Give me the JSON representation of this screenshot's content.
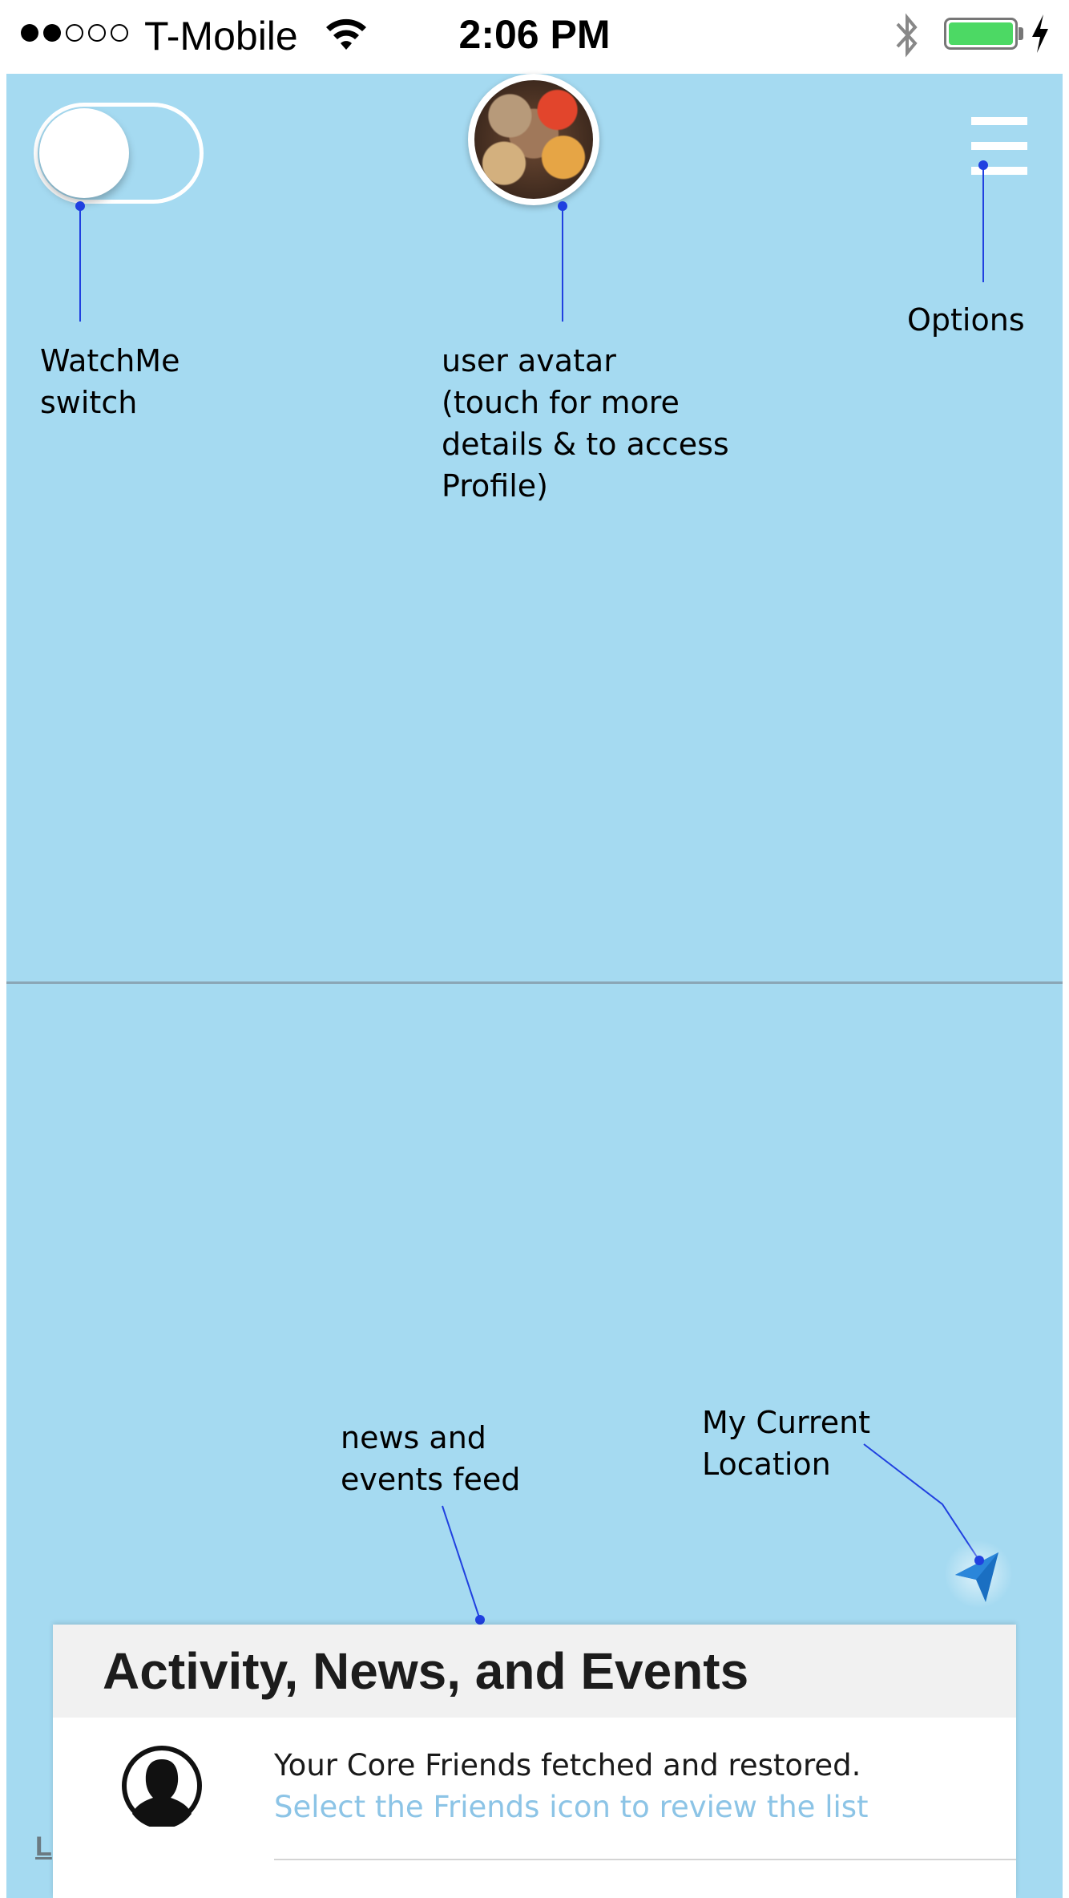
{
  "status_bar": {
    "signal_dots_filled": 2,
    "signal_dots_total": 5,
    "carrier": "T-Mobile",
    "time": "2:06 PM",
    "battery_level": 1.0,
    "battery_color": "#4cd964",
    "icons": [
      "wifi-icon",
      "bluetooth-icon",
      "battery-icon",
      "charging-icon"
    ]
  },
  "map": {
    "background_color": "#a5daf1"
  },
  "controls": {
    "watchme_switch_on": false,
    "avatar_icon": "user-avatar",
    "options_icon": "hamburger-menu-icon",
    "location_icon": "location-arrow-icon"
  },
  "annotations": {
    "watchme": "WatchMe\nswitch",
    "avatar": "user avatar\n(touch for more\ndetails & to access\nProfile)",
    "options": "Options",
    "feed": "news and\nevents feed",
    "location": "My Current\nLocation",
    "line_color": "#2040e0"
  },
  "left_label": "L",
  "feed": {
    "title": "Activity, News, and Events",
    "items": [
      {
        "icon": "person-silhouette-icon",
        "title": "Your Core Friends fetched and restored.",
        "subtitle": "Select the Friends icon to review the list"
      }
    ]
  }
}
